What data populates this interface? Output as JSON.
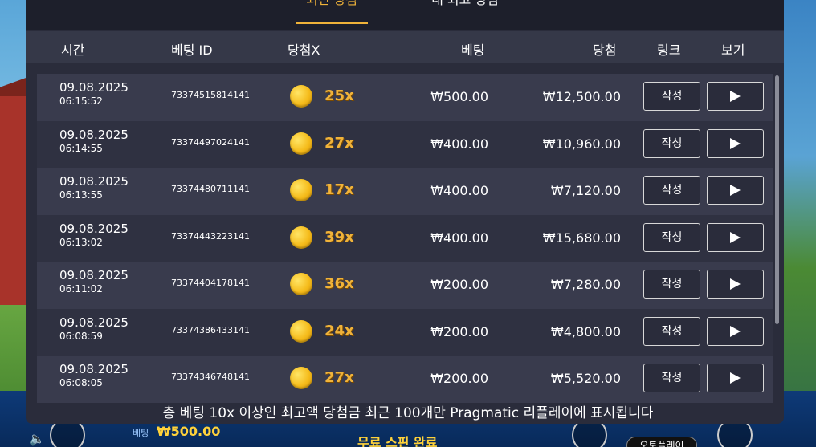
{
  "tabs": [
    {
      "label": "최신 당첨",
      "active": true
    },
    {
      "label": "내 최고 당첨",
      "active": false
    }
  ],
  "columns": {
    "time": "시간",
    "bet_id": "베팅 ID",
    "win_x": "당첨X",
    "bet": "베팅",
    "win": "당첨",
    "link": "링크",
    "view": "보기"
  },
  "rows": [
    {
      "date": "09.08.2025",
      "time": "06:15:52",
      "bet_id": "73374515814141",
      "mult": "25x",
      "bet": "₩500.00",
      "win": "₩12,500.00",
      "link_label": "작성"
    },
    {
      "date": "09.08.2025",
      "time": "06:14:55",
      "bet_id": "73374497024141",
      "mult": "27x",
      "bet": "₩400.00",
      "win": "₩10,960.00",
      "link_label": "작성"
    },
    {
      "date": "09.08.2025",
      "time": "06:13:55",
      "bet_id": "73374480711141",
      "mult": "17x",
      "bet": "₩400.00",
      "win": "₩7,120.00",
      "link_label": "작성"
    },
    {
      "date": "09.08.2025",
      "time": "06:13:02",
      "bet_id": "73374443223141",
      "mult": "39x",
      "bet": "₩400.00",
      "win": "₩15,680.00",
      "link_label": "작성"
    },
    {
      "date": "09.08.2025",
      "time": "06:11:02",
      "bet_id": "73374404178141",
      "mult": "36x",
      "bet": "₩200.00",
      "win": "₩7,280.00",
      "link_label": "작성"
    },
    {
      "date": "09.08.2025",
      "time": "06:08:59",
      "bet_id": "73374386433141",
      "mult": "24x",
      "bet": "₩200.00",
      "win": "₩4,800.00",
      "link_label": "작성"
    },
    {
      "date": "09.08.2025",
      "time": "06:08:05",
      "bet_id": "73374346748141",
      "mult": "27x",
      "bet": "₩200.00",
      "win": "₩5,520.00",
      "link_label": "작성"
    }
  ],
  "footer_note": "총 베팅 10x 이상인 최고액 당첨금 최근 100개만 Pragmatic 리플레이에 표시됩니다",
  "game_bar": {
    "bet_label": "베팅",
    "bet_value": "₩500.00",
    "free_spin_text": "무료 스핀 완료",
    "autoplay_label": "오토플레이"
  },
  "colors": {
    "accent": "#f0b33a",
    "panel_bg": "#2a2c3b",
    "row_odd": "#393b4d",
    "row_even": "#2f3141"
  },
  "icons": {
    "coin": "coin-icon",
    "play": "play-icon",
    "speaker": "speaker-icon"
  }
}
